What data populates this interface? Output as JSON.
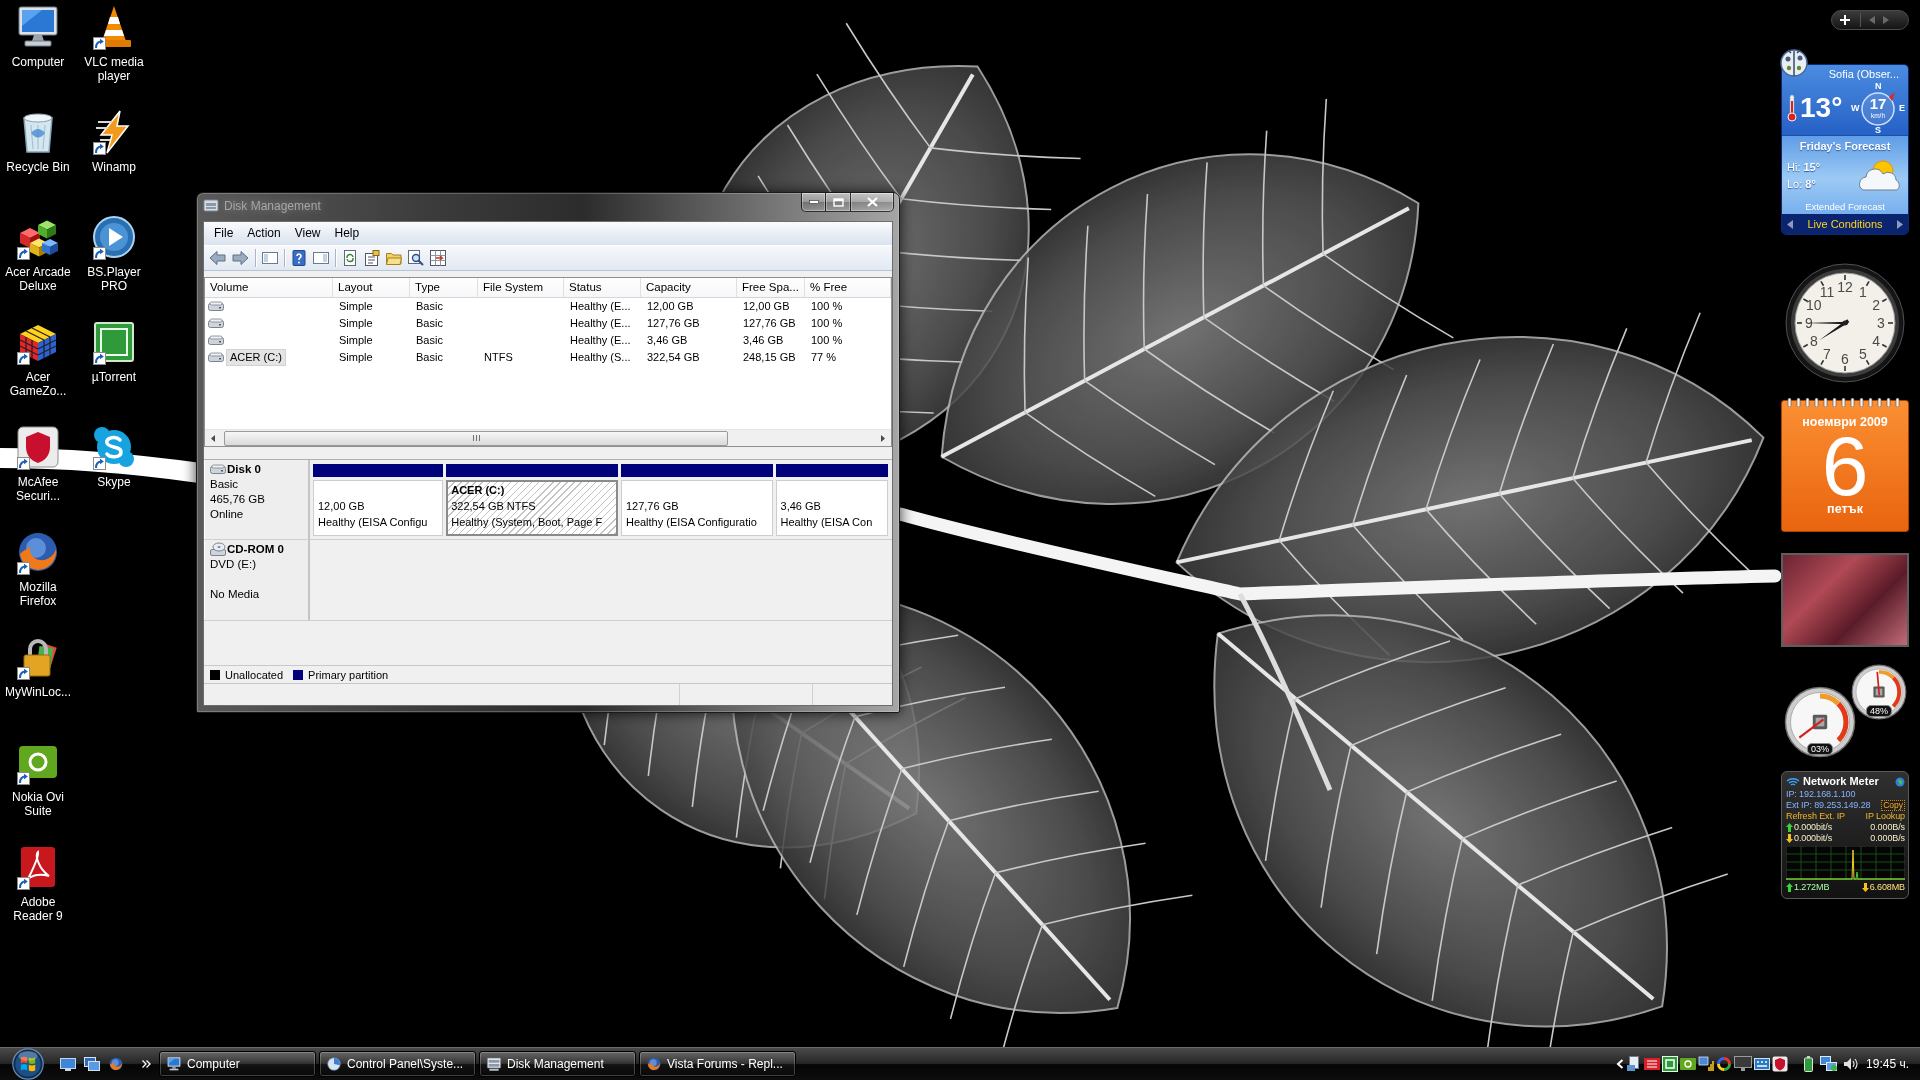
{
  "desktop_icons": [
    {
      "label": "Computer",
      "kind": "computer",
      "shortcut": false
    },
    {
      "label": "Recycle Bin",
      "kind": "trash",
      "shortcut": false
    },
    {
      "label": "Acer Arcade Deluxe",
      "kind": "cubes",
      "shortcut": true
    },
    {
      "label": "Acer GameZo...",
      "kind": "rubik",
      "shortcut": true
    },
    {
      "label": "McAfee Securi...",
      "kind": "mcafee",
      "shortcut": true
    },
    {
      "label": "Mozilla Firefox",
      "kind": "firefox",
      "shortcut": true
    },
    {
      "label": "MyWinLoc...",
      "kind": "lock",
      "shortcut": true
    },
    {
      "label": "Nokia Ovi Suite",
      "kind": "ovi",
      "shortcut": true
    },
    {
      "label": "Adobe Reader 9",
      "kind": "pdf",
      "shortcut": true
    },
    {
      "label": "VLC media player",
      "kind": "cone",
      "shortcut": true
    },
    {
      "label": "Winamp",
      "kind": "bolt",
      "shortcut": true
    },
    {
      "label": "BS.Player PRO",
      "kind": "player",
      "shortcut": true
    },
    {
      "label": "µTorrent",
      "kind": "torrent",
      "shortcut": true
    },
    {
      "label": "Skype",
      "kind": "skype",
      "shortcut": true
    }
  ],
  "window": {
    "title": "Disk Management",
    "menu": [
      "File",
      "Action",
      "View",
      "Help"
    ],
    "columns": [
      "Volume",
      "Layout",
      "Type",
      "File System",
      "Status",
      "Capacity",
      "Free Spa...",
      "% Free"
    ],
    "rows": [
      {
        "layout": "Simple",
        "type": "Basic",
        "status": "Healthy (E...",
        "capacity": "12,00 GB",
        "free_space": "12,00 GB",
        "percent_free": "100 %",
        "selected": false
      },
      {
        "layout": "Simple",
        "type": "Basic",
        "status": "Healthy (E...",
        "capacity": "127,76 GB",
        "free_space": "127,76 GB",
        "percent_free": "100 %",
        "selected": false
      },
      {
        "layout": "Simple",
        "type": "Basic",
        "status": "Healthy (E...",
        "capacity": "3,46 GB",
        "free_space": "3,46 GB",
        "percent_free": "100 %",
        "selected": false
      },
      {
        "volume": "ACER (C:)",
        "layout": "Simple",
        "type": "Basic",
        "file_system": "NTFS",
        "status": "Healthy (S...",
        "capacity": "322,54 GB",
        "free_space": "248,15 GB",
        "percent_free": "77 %",
        "selected": true
      }
    ],
    "disks": [
      {
        "kind": "disk",
        "name": "Disk 0",
        "type": "Basic",
        "size": "465,76 GB",
        "state": "Online",
        "partitions": [
          {
            "size": "12,00 GB",
            "status": "Healthy (EISA Configu",
            "selected": false
          },
          {
            "label": "ACER  (C:)",
            "size": "322,54 GB NTFS",
            "status": "Healthy (System, Boot, Page F",
            "selected": true
          },
          {
            "size": "127,76 GB",
            "status": "Healthy (EISA Configuratio",
            "selected": false
          },
          {
            "size": "3,46 GB",
            "status": "Healthy (EISA Con",
            "selected": false
          }
        ]
      },
      {
        "kind": "cdrom",
        "name": "CD-ROM 0",
        "type": "DVD (E:)",
        "state": "No Media"
      }
    ],
    "legend": [
      {
        "label": "Unallocated",
        "color": "#000000"
      },
      {
        "label": "Primary partition",
        "color": "#00007b"
      }
    ]
  },
  "gadgets": {
    "weather": {
      "location": "Sofia (Obser...",
      "temperature": "13°",
      "compass": [
        "N",
        "E",
        "S",
        "W"
      ],
      "wind_speed": "17",
      "wind_unit": "km/h",
      "forecast_title": "Friday's Forecast",
      "high": "Hi: **15°**",
      "low": "Lo: **8°**",
      "extended": "Extended Forecast",
      "live": "Live Conditions"
    },
    "clock": {
      "numerals": [
        "12",
        "11",
        "1",
        "10",
        "2",
        "9",
        "3",
        "8",
        "4",
        "7",
        "5",
        "6"
      ]
    },
    "calendar": {
      "month": "ноември 2009",
      "day": "6",
      "weekday": "петък"
    },
    "cpu_meter": {
      "gauges": [
        {
          "reading": "03%"
        },
        {
          "reading": "48%"
        }
      ]
    },
    "network_meter": {
      "title": "Network Meter",
      "ip": "IP: 192.168.1.100",
      "ext_ip": "Ext IP: 89.253.149.28",
      "copy": "Copy",
      "refresh": "Refresh Ext. IP",
      "lookup": "IP Lookup",
      "rates": [
        {
          "kind": "up",
          "bits": "0.000bit/s",
          "bytes": "0.000B/s"
        },
        {
          "kind": "down",
          "bits": "0.000bit/s",
          "bytes": "0.000B/s"
        }
      ],
      "totals": [
        {
          "kind": "up",
          "value": "1.272MB"
        },
        {
          "kind": "down",
          "value": "6.608MB"
        }
      ]
    }
  },
  "taskbar": {
    "tasks": [
      {
        "label": "Computer",
        "kind": "computer",
        "selected": false
      },
      {
        "label": "Control Panel\\Syste...",
        "kind": "control",
        "selected": false
      },
      {
        "label": "Disk Management",
        "kind": "disk",
        "selected": false
      },
      {
        "label": "Vista Forums - Repl...",
        "kind": "browser",
        "selected": false
      }
    ],
    "clock": "19:45 ч."
  }
}
